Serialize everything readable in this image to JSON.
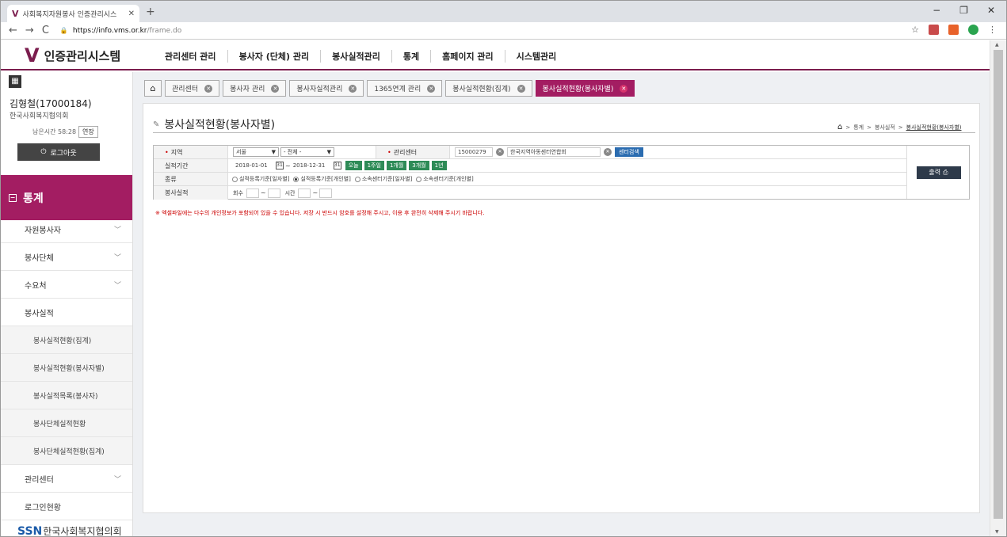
{
  "browser": {
    "tab_title": "사회복지자원봉사 인증관리시스",
    "tab_favicon": "V",
    "url_host": "https://info.vms.or.kr",
    "url_path": "/frame.do"
  },
  "site": {
    "logo_mark": "V",
    "logo_text": "인증관리시스템",
    "gnb": [
      "관리센터 관리",
      "봉사자 (단체) 관리",
      "봉사실적관리",
      "통계",
      "홈페이지 관리",
      "시스템관리"
    ]
  },
  "user": {
    "name": "김형철(17000184)",
    "org": "한국사회복지협의회",
    "remaining": "남은시간 58:28",
    "extend": "연장",
    "logout": "로그아웃"
  },
  "sidebar": {
    "category": "통계",
    "items": [
      {
        "label": "자원봉사자",
        "type": "top",
        "chevron": true
      },
      {
        "label": "봉사단체",
        "type": "top",
        "chevron": true
      },
      {
        "label": "수요처",
        "type": "top",
        "chevron": true
      },
      {
        "label": "봉사실적",
        "type": "top",
        "chevron": false
      },
      {
        "label": "봉사실적현황(집계)",
        "type": "sub"
      },
      {
        "label": "봉사실적현황(봉사자별)",
        "type": "sub"
      },
      {
        "label": "봉사실적목록(봉사자)",
        "type": "sub"
      },
      {
        "label": "봉사단체실적현황",
        "type": "sub"
      },
      {
        "label": "봉사단체실적현황(집계)",
        "type": "sub"
      },
      {
        "label": "관리센터",
        "type": "top",
        "chevron": true
      },
      {
        "label": "로그인현황",
        "type": "top",
        "chevron": false
      }
    ],
    "footer_logo_mark": "SSN",
    "footer_logo_text": "한국사회복지협의회"
  },
  "tabs": [
    {
      "label": "관리센터"
    },
    {
      "label": "봉사자 관리"
    },
    {
      "label": "봉사자실적관리"
    },
    {
      "label": "1365연계 관리"
    },
    {
      "label": "봉사실적현황(집계)"
    },
    {
      "label": "봉사실적현황(봉사자별)",
      "active": true
    }
  ],
  "page": {
    "title": "봉사실적현황(봉사자별)",
    "breadcrumb": [
      "통계",
      "봉사실적",
      "봉사실적현황(봉사자별)"
    ]
  },
  "search": {
    "region_label": "지역",
    "region_value": "서울",
    "region_sub": "- 전체 -",
    "center_label": "관리센터",
    "center_code": "15000279",
    "center_name": "한국지역아동센터연합회",
    "center_search": "센터검색",
    "period_label": "실적기간",
    "date_from": "2018-01-01",
    "date_to": "2018-12-31",
    "quick": [
      "오늘",
      "1주일",
      "1개월",
      "3개월",
      "1년"
    ],
    "type_label": "종류",
    "types": [
      {
        "label": "실적등록기준[일자별]",
        "checked": false
      },
      {
        "label": "실적등록기준[개인별]",
        "checked": true
      },
      {
        "label": "소속센터기준[일자별]",
        "checked": false
      },
      {
        "label": "소속센터기준[개인별]",
        "checked": false
      }
    ],
    "perf_label": "봉사실적",
    "count_label": "회수",
    "hours_label": "시간",
    "print_button": "출력"
  },
  "notice": "※ 엑셀파일에는 다수의 개인정보가 포함되어 있을 수 있습니다. 저장 시 반드시 암호를 설정해 주시고, 이용 후 완전히 삭제해 주시기 바랍니다."
}
